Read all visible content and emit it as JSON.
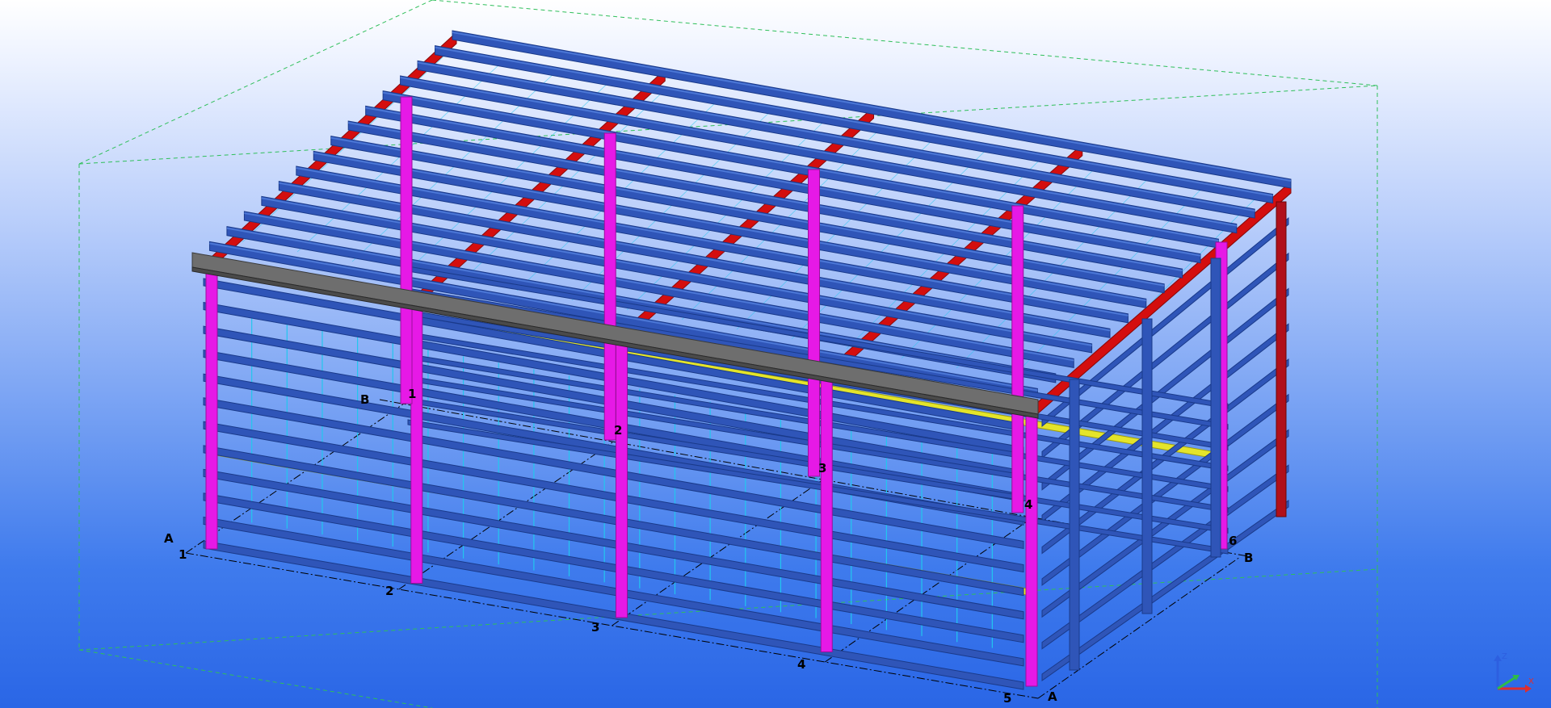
{
  "view": {
    "background_top": "#ffffff",
    "background_bottom": "#2a66e6",
    "work_area_color": "#2fbf5a"
  },
  "model": {
    "gridlines_row": [
      "1",
      "2",
      "3",
      "4",
      "5",
      "6"
    ],
    "gridlines_col": [
      "A",
      "B"
    ],
    "colors": {
      "purlin": "#2f55b8",
      "purlin_highlight": "#4b77d6",
      "rafter": "#d40e0e",
      "column": "#e619e6",
      "column_dark": "#9a0f9a",
      "eave_beam": "#6e6e6e",
      "bracing": "#22c6ee",
      "crane_beam": "#e4e42a",
      "gridline": "#000000"
    }
  },
  "axis_triad": {
    "x": "X",
    "y": "Y",
    "z": "Z"
  }
}
